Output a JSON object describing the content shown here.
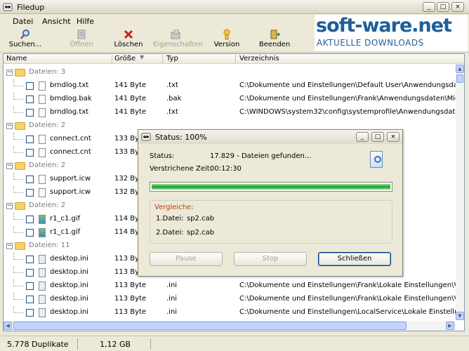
{
  "window": {
    "title": "Filedup",
    "controls": [
      "_",
      "□",
      "×"
    ]
  },
  "menu": [
    "Datei",
    "Ansicht",
    "Hilfe"
  ],
  "toolbar": [
    {
      "label": "Suchen...",
      "icon": "search-icon",
      "enabled": true
    },
    {
      "label": "Öffnen",
      "icon": "open-icon",
      "enabled": false
    },
    {
      "label": "Löschen",
      "icon": "delete-icon",
      "enabled": true
    },
    {
      "label": "Eigenschaften",
      "icon": "properties-icon",
      "enabled": false
    },
    {
      "label": "Version",
      "icon": "info-icon",
      "enabled": true
    },
    {
      "label": "Beenden",
      "icon": "exit-icon",
      "enabled": true
    }
  ],
  "watermark": {
    "main": "soft-ware.net",
    "sub": "AKTUELLE DOWNLOADS"
  },
  "columns": [
    "Name",
    "Größe",
    "Typ",
    "Verzeichnis"
  ],
  "groups": [
    {
      "label": "Dateien: 3",
      "files": [
        {
          "name": "brndlog.txt",
          "size": "141 Byte",
          "type": ".txt",
          "dir": "C:\\Dokumente und Einstellungen\\Default User\\Anwendungsdaten\\Microsof"
        },
        {
          "name": "brndlog.bak",
          "size": "141 Byte",
          "type": ".bak",
          "dir": "C:\\Dokumente und Einstellungen\\Frank\\Anwendungsdaten\\Microsoft\\Inter"
        },
        {
          "name": "brndlog.txt",
          "size": "141 Byte",
          "type": ".txt",
          "dir": "C:\\WINDOWS\\system32\\config\\systemprofile\\Anwendungsdaten\\Microsof"
        }
      ]
    },
    {
      "label": "Dateien: 2",
      "files": [
        {
          "name": "connect.cnt",
          "size": "133 Byte",
          "type": "",
          "dir": ""
        },
        {
          "name": "connect.cnt",
          "size": "133 Byte",
          "type": "",
          "dir": ""
        }
      ]
    },
    {
      "label": "Dateien: 2",
      "files": [
        {
          "name": "support.icw",
          "size": "132 Byte",
          "type": "",
          "dir": ""
        },
        {
          "name": "support.icw",
          "size": "132 Byte",
          "type": "",
          "dir": ""
        }
      ]
    },
    {
      "label": "Dateien: 2",
      "files": [
        {
          "name": "r1_c1.gif",
          "size": "114 Byte",
          "type": "",
          "dir": "phics\\"
        },
        {
          "name": "r1_c1.gif",
          "size": "114 Byte",
          "type": "",
          "dir": "ft Corporation,L="
        }
      ]
    },
    {
      "label": "Dateien: 11",
      "files": [
        {
          "name": "desktop.ini",
          "size": "113 Byte",
          "type": "",
          "dir": "stellungen\\Verlauf"
        },
        {
          "name": "desktop.ini",
          "size": "113 Byte",
          "type": "",
          "dir": "stellungen\\Verlauf"
        },
        {
          "name": "desktop.ini",
          "size": "113 Byte",
          "type": ".ini",
          "dir": "C:\\Dokumente und Einstellungen\\Frank\\Lokale Einstellungen\\Verlauf\\"
        },
        {
          "name": "desktop.ini",
          "size": "113 Byte",
          "type": ".ini",
          "dir": "C:\\Dokumente und Einstellungen\\Frank\\Lokale Einstellungen\\Verlauf\\Histor"
        },
        {
          "name": "desktop.ini",
          "size": "113 Byte",
          "type": ".ini",
          "dir": "C:\\Dokumente und Einstellungen\\LocalService\\Lokale Einstellungen\\Verlau"
        }
      ]
    }
  ],
  "statusbar": {
    "duplicates": "5.778 Duplikate",
    "size": "1,12 GB"
  },
  "dialog": {
    "title": "Status: 100%",
    "status_label": "Status:",
    "status_value": "17.829 - Dateien gefunden...",
    "elapsed_label": "Verstrichene Zeit:",
    "elapsed_value": "00:12:30",
    "progress": 1.0,
    "group_title": "Vergleiche:",
    "file1_label": "1.Datei:",
    "file1_value": "sp2.cab",
    "file2_label": "2.Datei:",
    "file2_value": "sp2.cab",
    "pause": "Pause",
    "stop": "Stop",
    "close": "Schließen"
  }
}
